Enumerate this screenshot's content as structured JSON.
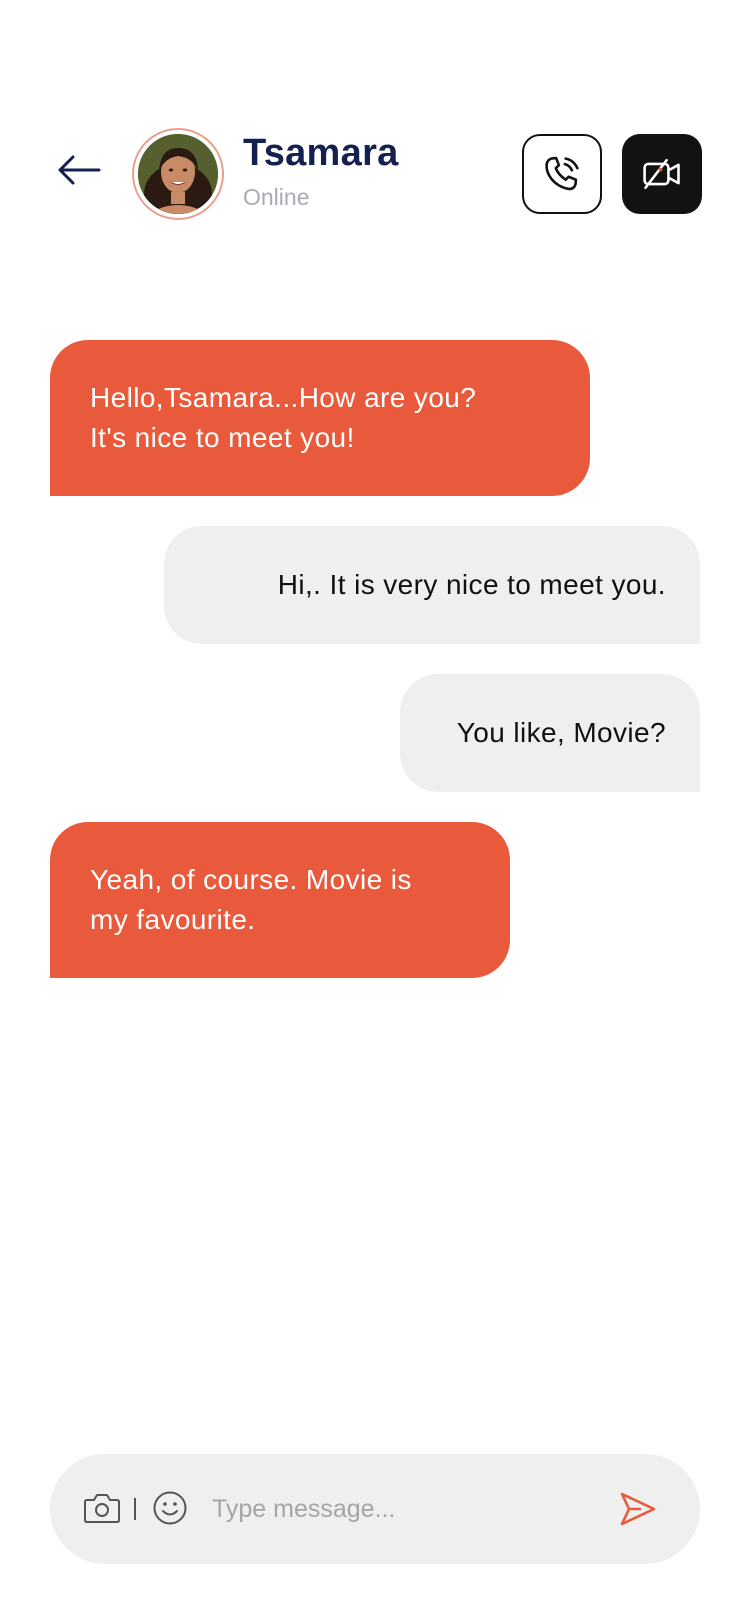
{
  "header": {
    "contact_name": "Tsamara",
    "status": "Online"
  },
  "icons": {
    "back": "arrow-left-icon",
    "call": "phone-icon",
    "video": "video-off-icon",
    "camera": "camera-icon",
    "emoji": "emoji-icon",
    "send": "send-icon"
  },
  "messages": [
    {
      "direction": "incoming",
      "lines": [
        "Hello,Tsamara...How are you?",
        "It's nice to meet you!"
      ]
    },
    {
      "direction": "outgoing",
      "text": "Hi,. It is very nice to meet you."
    },
    {
      "direction": "outgoing",
      "text": "You like, Movie?"
    },
    {
      "direction": "incoming",
      "lines": [
        "Yeah, of course. Movie is",
        "my favourite."
      ]
    }
  ],
  "composer": {
    "divider": "|",
    "placeholder": "Type message..."
  },
  "colors": {
    "accent": "#e85a3b",
    "incoming_bubble": "#e85a3b",
    "outgoing_bubble": "#efefef",
    "title": "#14204f",
    "status": "#a7abb9",
    "dark_button": "#121212"
  }
}
